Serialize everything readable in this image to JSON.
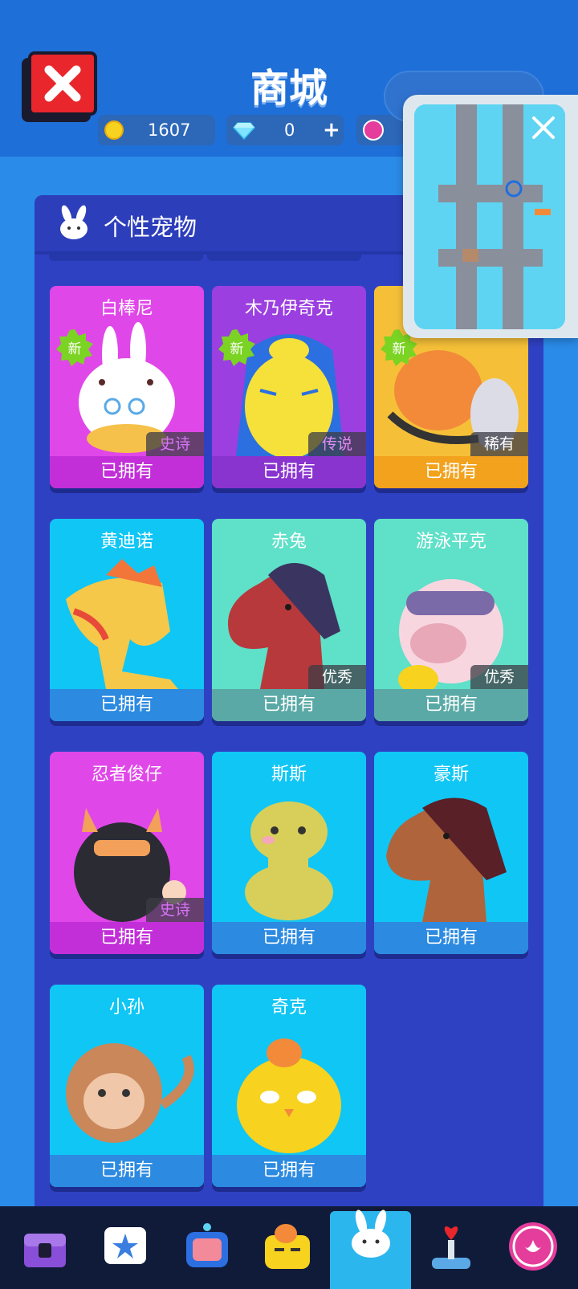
{
  "header": {
    "title": "商城",
    "coins": "1607",
    "gems": "0",
    "add_label": "+"
  },
  "panel": {
    "title": "个性宠物"
  },
  "cards": [
    {
      "name": "白棒尼",
      "status": "已拥有",
      "rarity": "史诗",
      "is_new": true
    },
    {
      "name": "木乃伊奇克",
      "status": "已拥有",
      "rarity": "传说",
      "is_new": true
    },
    {
      "name": "",
      "status": "已拥有",
      "rarity": "稀有",
      "is_new": true
    },
    {
      "name": "黄迪诺",
      "status": "已拥有",
      "rarity": "",
      "is_new": false
    },
    {
      "name": "赤兔",
      "status": "已拥有",
      "rarity": "优秀",
      "is_new": false
    },
    {
      "name": "游泳平克",
      "status": "已拥有",
      "rarity": "优秀",
      "is_new": false
    },
    {
      "name": "忍者俊仔",
      "status": "已拥有",
      "rarity": "史诗",
      "is_new": false
    },
    {
      "name": "斯斯",
      "status": "已拥有",
      "rarity": "",
      "is_new": false
    },
    {
      "name": "豪斯",
      "status": "已拥有",
      "rarity": "",
      "is_new": false
    },
    {
      "name": "小孙",
      "status": "已拥有",
      "rarity": "",
      "is_new": false
    },
    {
      "name": "奇克",
      "status": "已拥有",
      "rarity": "",
      "is_new": false
    }
  ],
  "badges": {
    "new_label": "新"
  },
  "nav": {
    "items": [
      "chest-icon",
      "star-card-icon",
      "robot-tv-icon",
      "chick-face-icon",
      "bunny-pet-icon",
      "joystick-heart-icon",
      "lotus-icon"
    ],
    "active": "bunny-pet-icon"
  },
  "colors": {
    "epic": "#c64bea",
    "legend": "#9b3fe0",
    "rare": "#f5b63a",
    "blue": "#10c6f5",
    "teal": "#5fe0c8"
  }
}
